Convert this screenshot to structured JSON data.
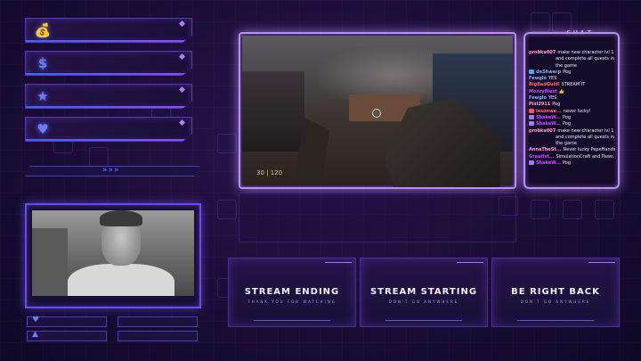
{
  "chat": {
    "title": "CHAT",
    "messages": [
      {
        "user": "probka007",
        "user_color": "#ff9ee0",
        "badge": "",
        "text": "make new character lvl 1"
      },
      {
        "user": "",
        "user_color": "#ffffff",
        "badge": "",
        "text": "and complete all quests in"
      },
      {
        "user": "",
        "user_color": "#ffffff",
        "badge": "",
        "text": "the game"
      },
      {
        "user": "deShwerp",
        "user_color": "#7ab8ff",
        "badge": "#4aa8ff",
        "text": "Pog"
      },
      {
        "user": "Fewglo",
        "user_color": "#7ab8ff",
        "badge": "",
        "text": "YES"
      },
      {
        "user": "BigBadGuidi",
        "user_color": "#ff6b6b",
        "badge": "",
        "text": "STREAM IT"
      },
      {
        "user": "Mozzyfliest",
        "user_color": "#c94dff",
        "badge": "",
        "text": "👍"
      },
      {
        "user": "Fewglo",
        "user_color": "#7ab8ff",
        "badge": "",
        "text": "YES"
      },
      {
        "user": "Pixl2911",
        "user_color": "#ff9ee0",
        "badge": "",
        "text": "Pog"
      },
      {
        "user": "lesonwe...",
        "user_color": "#ff6b6b",
        "badge": "#ff4d6d",
        "text": "never lucky!"
      },
      {
        "user": "ShakeW...",
        "user_color": "#c94dff",
        "badge": "#9b7cff",
        "text": "Pog"
      },
      {
        "user": "ShakeW...",
        "user_color": "#c94dff",
        "badge": "#9b7cff",
        "text": "Pog"
      },
      {
        "user": "probka007",
        "user_color": "#ff9ee0",
        "badge": "",
        "text": "make new character lvl 1"
      },
      {
        "user": "",
        "user_color": "#ffffff",
        "badge": "",
        "text": "and complete all quests in"
      },
      {
        "user": "",
        "user_color": "#ffffff",
        "badge": "",
        "text": "the game"
      },
      {
        "user": "AnnaTheSt...",
        "user_color": "#ff9ee0",
        "badge": "",
        "text": "Never lucky PepeHands"
      },
      {
        "user": "Greatist...",
        "user_color": "#c94dff",
        "badge": "",
        "text": "SimulationCraft and Pawn"
      },
      {
        "user": "ShakeW...",
        "user_color": "#c94dff",
        "badge": "#9b7cff",
        "text": "Pog"
      }
    ]
  },
  "stats": [
    {
      "icon": "money-bag-icon",
      "glyph": "💰"
    },
    {
      "icon": "dollar-icon",
      "glyph": "$"
    },
    {
      "icon": "star-icon",
      "glyph": "★"
    },
    {
      "icon": "heart-icon",
      "glyph": "♥"
    }
  ],
  "divider": {
    "arrows": "»»»"
  },
  "game": {
    "ammo": "30 | 120"
  },
  "scenes": [
    {
      "title": "STREAM ENDING",
      "subtitle": "THANK YOU FOR WATCHING"
    },
    {
      "title": "STREAM STARTING",
      "subtitle": "DON'T GO ANYWHERE"
    },
    {
      "title": "BE RIGHT BACK",
      "subtitle": "DON'T GO ANYWHERE"
    }
  ],
  "bottom_bars": [
    {
      "icon": "heart-icon",
      "glyph": "♥"
    },
    {
      "icon": "money-bag-icon",
      "glyph": "▲"
    }
  ],
  "colors": {
    "accent": "#b98cff",
    "primary": "#6a4ae8",
    "background": "#1a0d36"
  }
}
